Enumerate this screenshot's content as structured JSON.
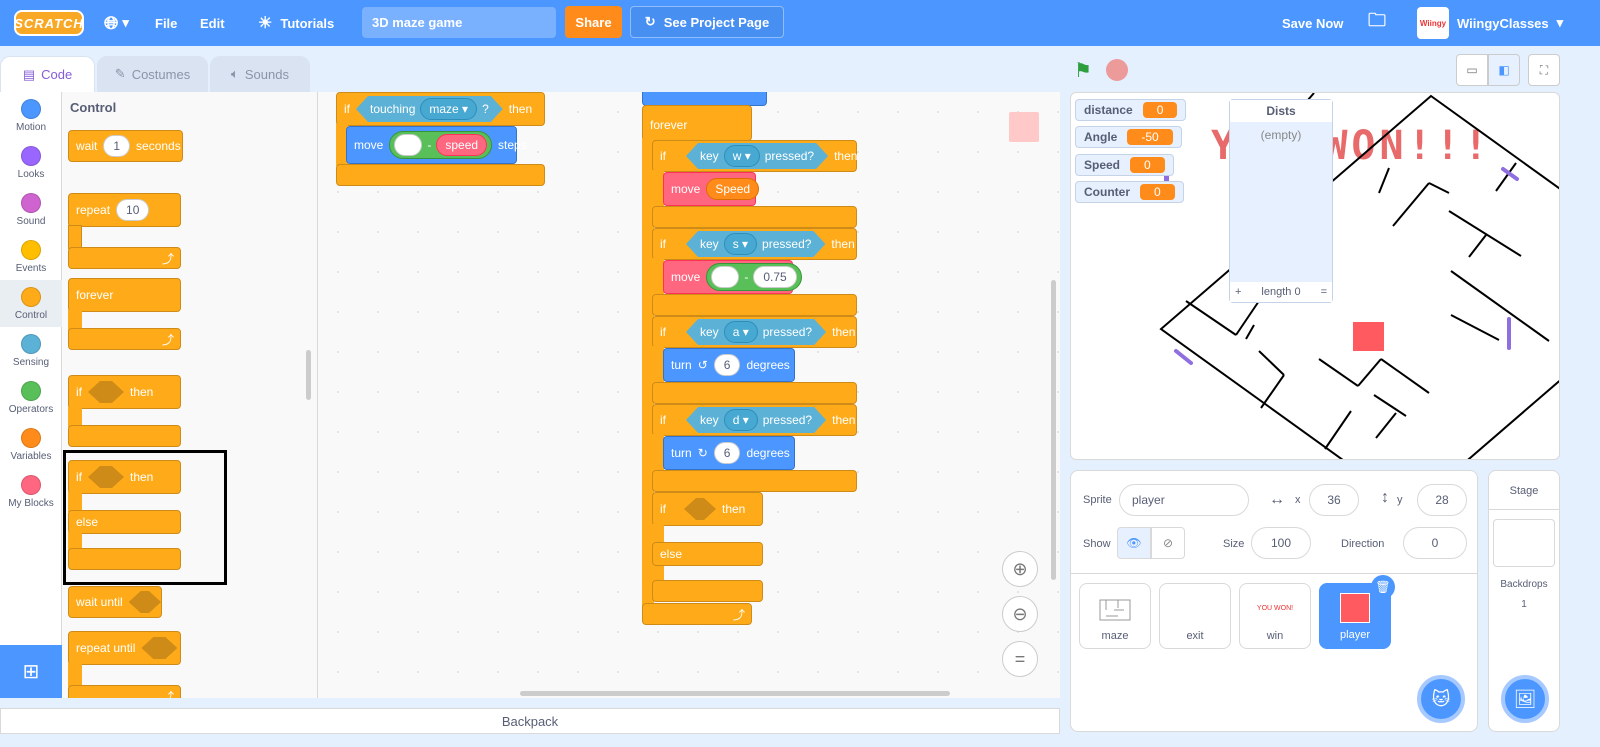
{
  "menubar": {
    "logo": "SCRATCH",
    "language_caret": "▾",
    "file": "File",
    "edit": "Edit",
    "tutorials": "Tutorials",
    "project_title": "3D maze game",
    "share": "Share",
    "see_project_page": "See Project Page",
    "save_now": "Save Now",
    "avatar_text": "Wiingy",
    "username": "WiingyClasses",
    "user_caret": "▾"
  },
  "tabs": [
    {
      "label": "Code"
    },
    {
      "label": "Costumes"
    },
    {
      "label": "Sounds"
    }
  ],
  "categories": [
    {
      "label": "Motion",
      "color": "#4c97ff"
    },
    {
      "label": "Looks",
      "color": "#9966ff"
    },
    {
      "label": "Sound",
      "color": "#cf63cf"
    },
    {
      "label": "Events",
      "color": "#ffbf00"
    },
    {
      "label": "Control",
      "color": "#ffab19"
    },
    {
      "label": "Sensing",
      "color": "#5cb1d6"
    },
    {
      "label": "Operators",
      "color": "#59c059"
    },
    {
      "label": "Variables",
      "color": "#ff8c1a"
    },
    {
      "label": "My Blocks",
      "color": "#ff6680"
    }
  ],
  "palette": {
    "title": "Control",
    "wait": "wait",
    "wait_value": "1",
    "seconds": "seconds",
    "repeat": "repeat",
    "repeat_value": "10",
    "forever": "forever",
    "if": "if",
    "then": "then",
    "else": "else",
    "wait_until": "wait until",
    "repeat_until": "repeat until"
  },
  "scripts": {
    "left": {
      "if": "if",
      "touching": "touching",
      "touching_menu": "maze",
      "q": "?",
      "then": "then",
      "move": "move",
      "minus": "-",
      "speed": "speed",
      "steps": "steps"
    },
    "right": {
      "forever": "forever",
      "if": "if",
      "then": "then",
      "else": "else",
      "key": "key",
      "pressed": "pressed?",
      "key_w": "w",
      "key_s": "s",
      "key_a": "a",
      "key_d": "d",
      "move": "move",
      "speed_var": "Speed",
      "minus": "-",
      "value_075": "0.75",
      "turn": "turn",
      "degrees": "degrees",
      "turn_value": "6"
    }
  },
  "stage": {
    "monitors": [
      {
        "label": "distance",
        "value": "0"
      },
      {
        "label": "Angle",
        "value": "-50"
      },
      {
        "label": "Speed",
        "value": "0"
      },
      {
        "label": "Counter",
        "value": "0"
      }
    ],
    "list": {
      "title": "Dists",
      "empty": "(empty)",
      "add": "+",
      "length": "length 0",
      "resize": "="
    },
    "win_text": "YOU WON!!!"
  },
  "sprite_info": {
    "sprite_label": "Sprite",
    "sprite_name": "player",
    "x_label": "x",
    "x": "36",
    "y_label": "y",
    "y": "28",
    "show_label": "Show",
    "size_label": "Size",
    "size": "100",
    "direction_label": "Direction",
    "direction": "0"
  },
  "sprites": [
    {
      "name": "maze"
    },
    {
      "name": "exit"
    },
    {
      "name": "win",
      "thumb_text": "YOU WON!"
    },
    {
      "name": "player",
      "selected": true
    }
  ],
  "stage_panel": {
    "title": "Stage",
    "backdrops_label": "Backdrops",
    "backdrops_count": "1"
  },
  "backpack": "Backpack",
  "zoom": {
    "reset": "="
  }
}
